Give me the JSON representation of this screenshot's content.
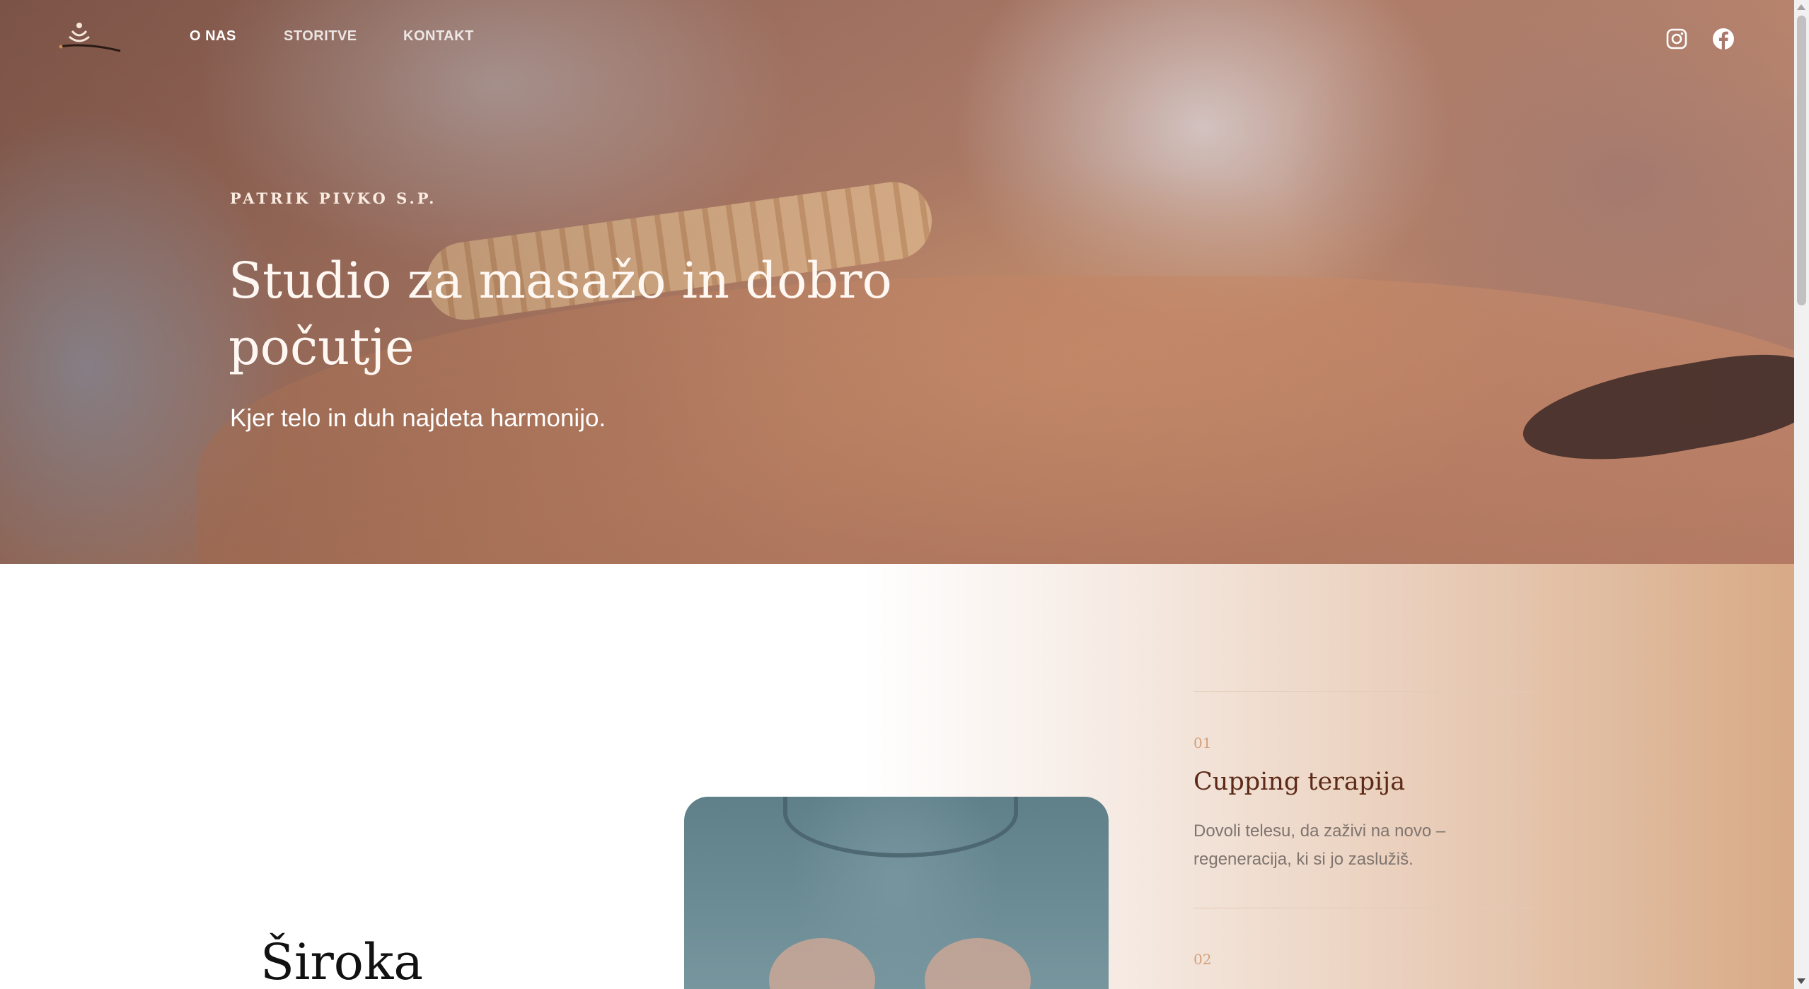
{
  "nav": {
    "items": [
      {
        "label": "O NAS",
        "active": true
      },
      {
        "label": "STORITVE",
        "active": false
      },
      {
        "label": "KONTAKT",
        "active": false
      }
    ],
    "social_icons": [
      "instagram-icon",
      "facebook-icon"
    ],
    "logo_icon": "lotus-hands-logo"
  },
  "hero": {
    "eyebrow": "PATRIK PIVKO S.P.",
    "title": "Studio za masažo in dobro počutje",
    "subtitle": "Kjer telo in duh najdeta harmonijo."
  },
  "about": {
    "heading": "Široka"
  },
  "services": [
    {
      "number": "01",
      "title": "Cupping terapija",
      "description": "Dovoli telesu, da zaživi na novo – regeneracija, ki si jo zaslužiš."
    },
    {
      "number": "02"
    }
  ],
  "colors": {
    "accent": "#d4a07a",
    "service_title": "#5c2a17",
    "gradient_end": "#d8aa86"
  }
}
